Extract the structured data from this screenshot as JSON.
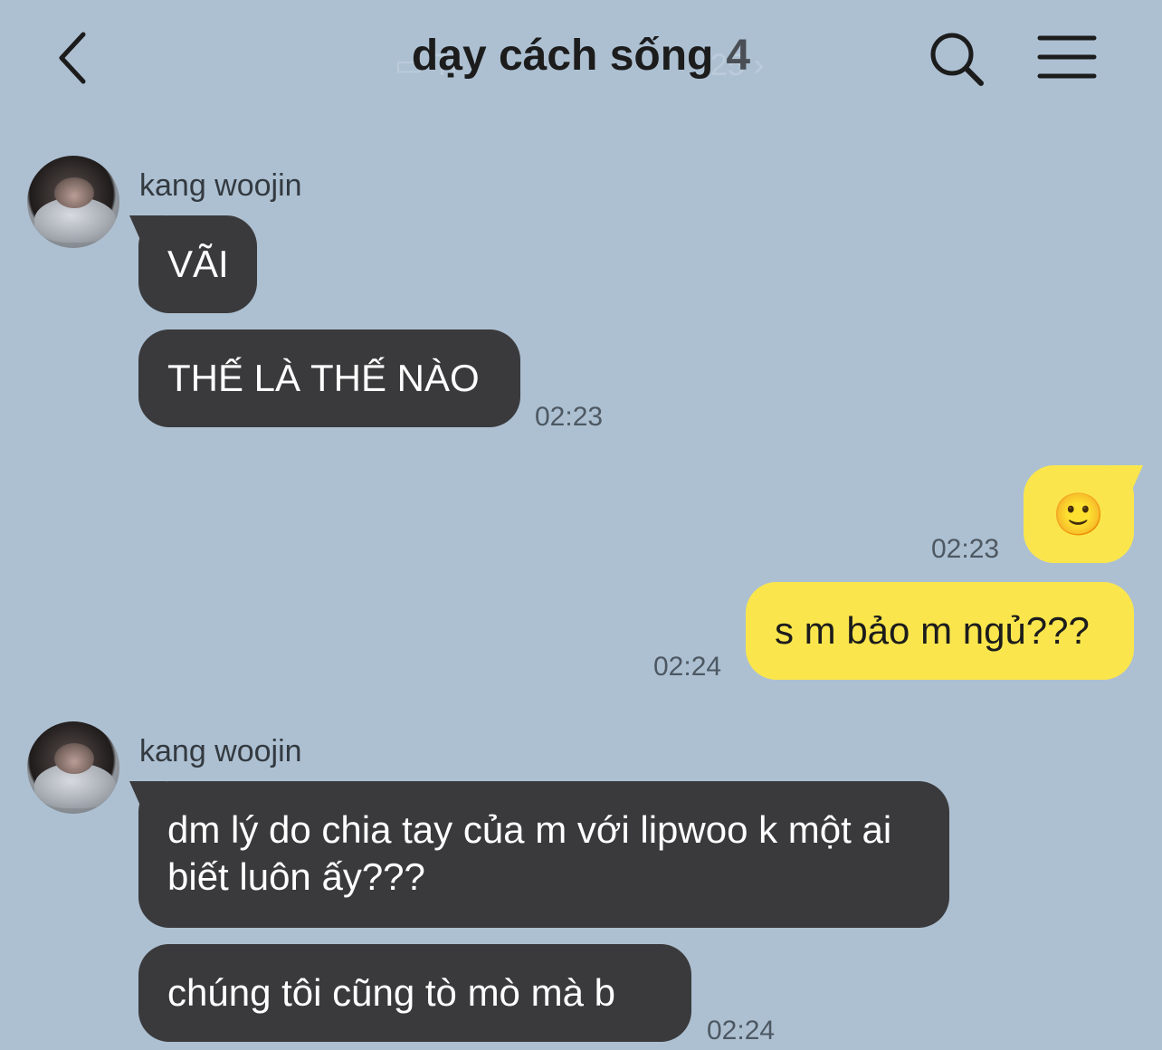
{
  "header": {
    "title": "dạy cách sống",
    "member_count": "4",
    "background_label": "Ti",
    "background_date": "25"
  },
  "messages": [
    {
      "sender": "kang woojin",
      "text": "VÃI",
      "direction": "received"
    },
    {
      "sender": "kang woojin",
      "text": "THẾ LÀ THẾ NÀO",
      "time": "02:23",
      "direction": "received"
    },
    {
      "sender": "me",
      "text": "🙂",
      "time": "02:23",
      "direction": "sent"
    },
    {
      "sender": "me",
      "text": "s m bảo m ngủ???",
      "time": "02:24",
      "direction": "sent"
    },
    {
      "sender": "kang woojin",
      "text": "dm lý do chia tay của m với lipwoo k một ai biết luôn ấy???",
      "direction": "received"
    },
    {
      "sender": "kang woojin",
      "text": "chúng tôi cũng tò mò mà b",
      "time": "02:24",
      "direction": "received"
    }
  ],
  "icons": {
    "back": "chevron-left-icon",
    "search": "search-icon",
    "menu": "hamburger-menu-icon"
  },
  "colors": {
    "background": "#adc0d2",
    "received_bubble": "#3a3a3c",
    "sent_bubble": "#fae64c"
  }
}
